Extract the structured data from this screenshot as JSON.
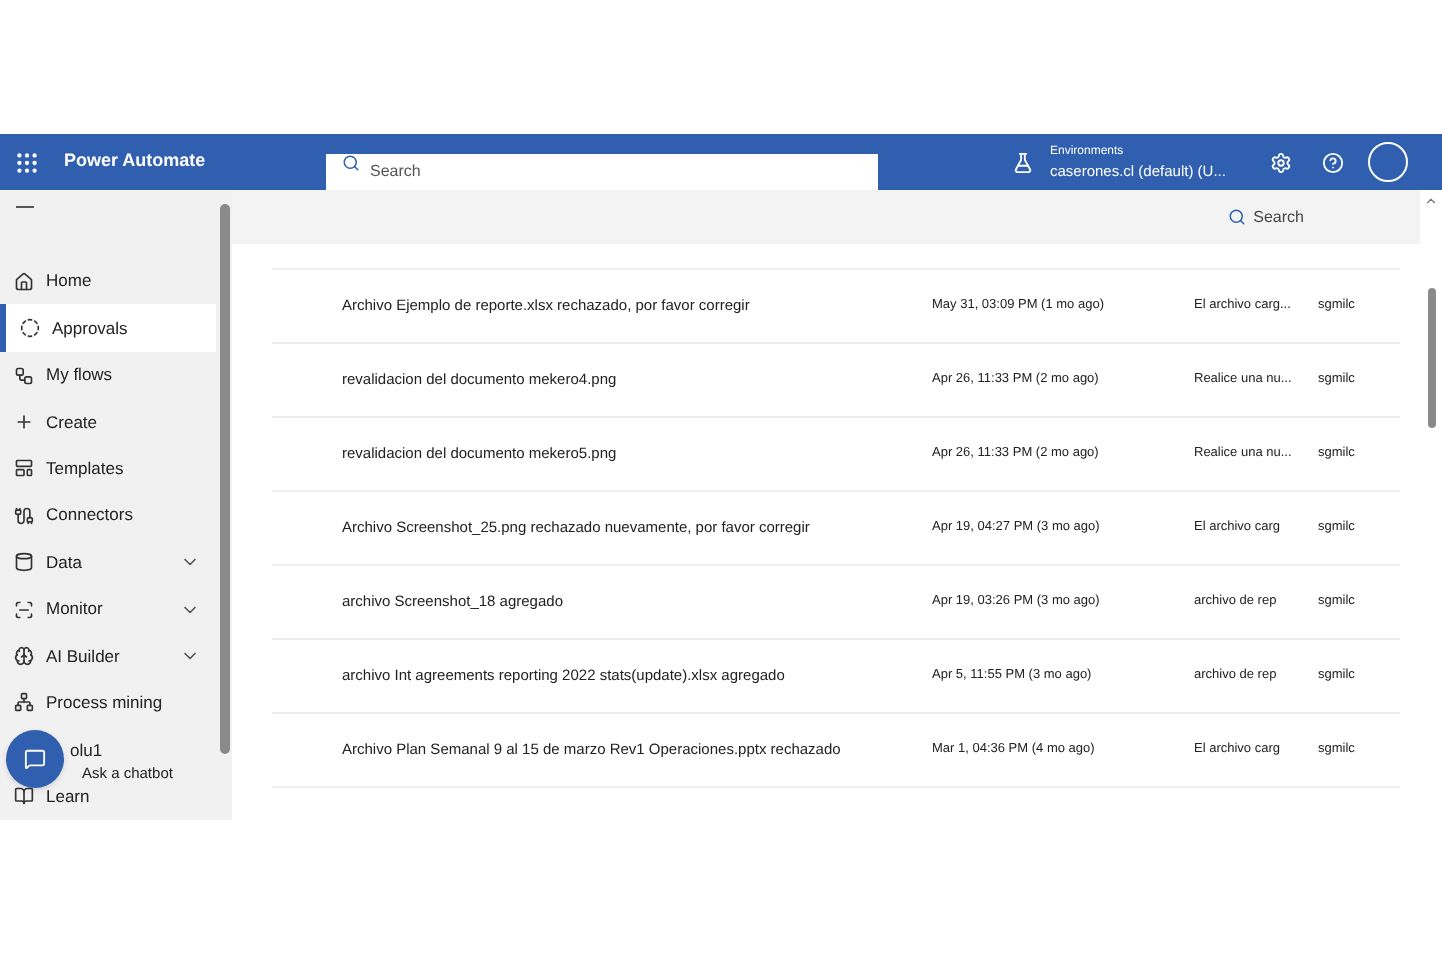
{
  "header": {
    "app_name": "Power Automate",
    "search": {
      "placeholder": "Search"
    },
    "environment": {
      "label": "Environments",
      "value": "caserones.cl (default) (U..."
    }
  },
  "sidebar": {
    "items": [
      {
        "label": "Home",
        "selected": false,
        "expandable": false
      },
      {
        "label": "Approvals",
        "selected": true,
        "expandable": false
      },
      {
        "label": "My flows",
        "selected": false,
        "expandable": false
      },
      {
        "label": "Create",
        "selected": false,
        "expandable": false
      },
      {
        "label": "Templates",
        "selected": false,
        "expandable": false
      },
      {
        "label": "Connectors",
        "selected": false,
        "expandable": false
      },
      {
        "label": "Data",
        "selected": false,
        "expandable": true
      },
      {
        "label": "Monitor",
        "selected": false,
        "expandable": true
      },
      {
        "label": "AI Builder",
        "selected": false,
        "expandable": true
      },
      {
        "label": "Process mining",
        "selected": false,
        "expandable": false
      },
      {
        "label": "olu1",
        "selected": false,
        "expandable": false
      },
      {
        "label": "Learn",
        "selected": false,
        "expandable": false
      }
    ],
    "chatbot": {
      "label": "Ask a chatbot"
    }
  },
  "toolbar": {
    "search": {
      "placeholder": "Search"
    }
  },
  "table": {
    "rows": [
      {
        "title": "Archivo Ejemplo de reporte.xlsx rechazado, por favor corregir",
        "date": "May 31, 03:09 PM (1 mo ago)",
        "column_3": "El archivo carg...",
        "column_4": "sgmilc"
      },
      {
        "title": "revalidacion del documento mekero4.png",
        "date": "Apr 26, 11:33 PM (2 mo ago)",
        "column_3": "Realice una nu...",
        "column_4": "sgmilc"
      },
      {
        "title": "revalidacion del documento mekero5.png",
        "date": "Apr 26, 11:33 PM (2 mo ago)",
        "column_3": "Realice una nu...",
        "column_4": "sgmilc"
      },
      {
        "title": "Archivo Screenshot_25.png rechazado nuevamente, por favor corregir",
        "date": "Apr 19, 04:27 PM (3 mo ago)",
        "column_3": "El archivo carg",
        "column_4": "sgmilc"
      },
      {
        "title": "archivo Screenshot_18 agregado",
        "date": "Apr 19, 03:26 PM (3 mo ago)",
        "column_3": "archivo de rep",
        "column_4": "sgmilc"
      },
      {
        "title": "archivo Int agreements reporting 2022 stats(update).xlsx agregado",
        "date": "Apr 5, 11:55 PM (3 mo ago)",
        "column_3": "archivo de rep",
        "column_4": "sgmilc"
      },
      {
        "title": "Archivo Plan Semanal 9 al 15 de marzo Rev1 Operaciones.pptx rechazado",
        "date": "Mar 1, 04:36 PM (4 mo ago)",
        "column_3": "El archivo carg",
        "column_4": "sgmilc"
      }
    ]
  }
}
